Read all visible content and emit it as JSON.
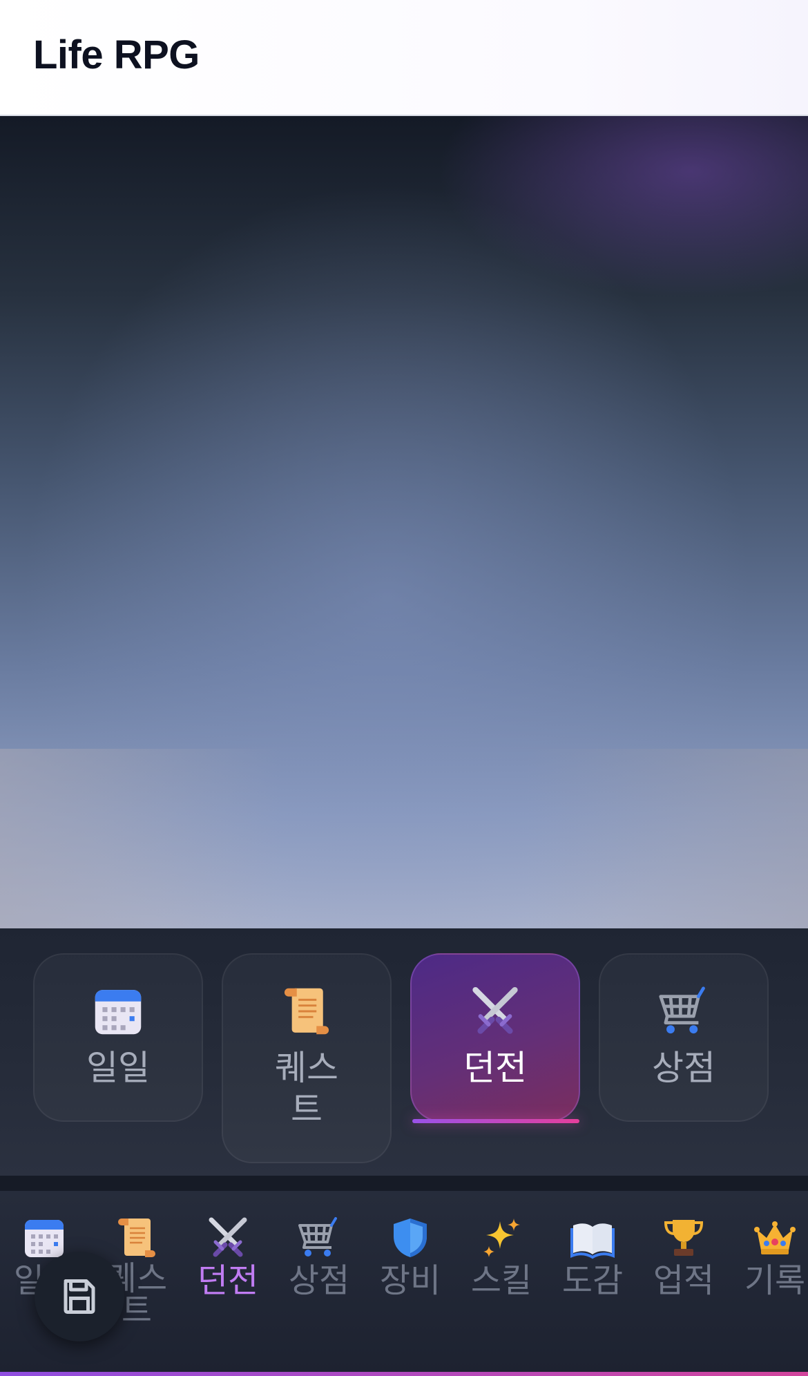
{
  "header": {
    "title": "Life RPG"
  },
  "tabs": [
    {
      "label": "일일",
      "icon": "calendar-icon"
    },
    {
      "label": "퀘스\n트",
      "icon": "scroll-icon"
    },
    {
      "label": "던전",
      "icon": "crossed-swords-icon",
      "active": true
    },
    {
      "label": "상점",
      "icon": "shopping-cart-icon"
    }
  ],
  "bottom_nav": [
    {
      "label": "일일",
      "icon": "calendar-icon"
    },
    {
      "label": "퀘스\n트",
      "icon": "scroll-icon"
    },
    {
      "label": "던전",
      "icon": "crossed-swords-icon",
      "active": true
    },
    {
      "label": "상점",
      "icon": "shopping-cart-icon"
    },
    {
      "label": "장비",
      "icon": "shield-icon"
    },
    {
      "label": "스킬",
      "icon": "sparkles-icon"
    },
    {
      "label": "도감",
      "icon": "open-book-icon"
    },
    {
      "label": "업적",
      "icon": "trophy-icon"
    },
    {
      "label": "기록",
      "icon": "crown-icon"
    }
  ],
  "fab": {
    "icon": "save-icon"
  },
  "colors": {
    "accent": "#9a52e8",
    "accent_pink": "#e53f9c",
    "active_label": "#c07cf2"
  }
}
